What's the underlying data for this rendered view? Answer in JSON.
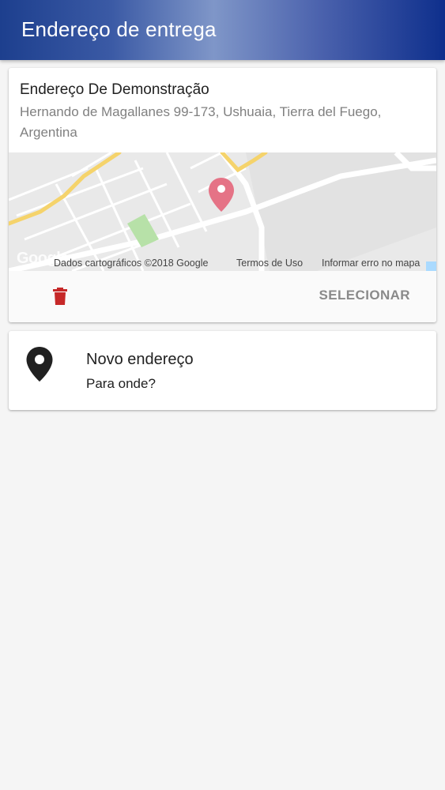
{
  "appbar": {
    "title": "Endereço de entrega"
  },
  "address_card": {
    "name": "Endereço De Demonstração",
    "address": "Hernando de Magallanes 99-173, Ushuaia, Tierra del Fuego, Argentina",
    "map": {
      "logo": "Google",
      "attribution_data": "Dados cartográficos ©2018 Google",
      "attribution_terms": "Termos de Uso",
      "attribution_report": "Informar erro no mapa",
      "marker_icon": "map-marker-icon",
      "marker_color": "#e57386"
    },
    "delete_icon": "trash-icon",
    "delete_color": "#c62828",
    "select_label": "SELECIONAR"
  },
  "new_address_card": {
    "icon": "map-pin-icon",
    "title": "Novo endereço",
    "subtitle": "Para onde?"
  }
}
